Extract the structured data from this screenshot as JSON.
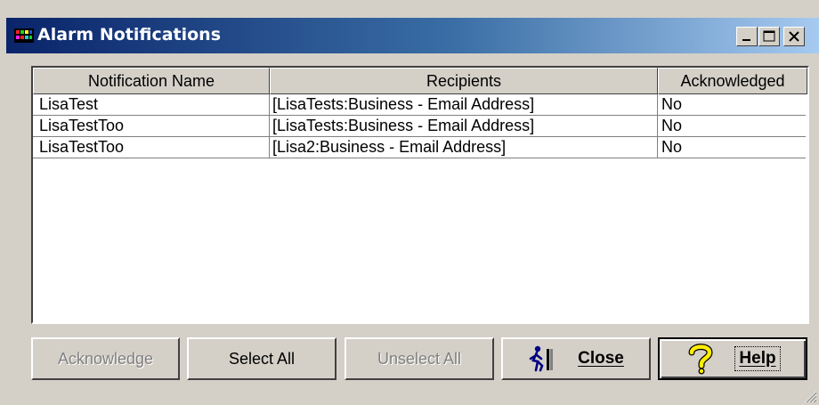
{
  "window": {
    "title": "Alarm Notifications",
    "icon": "alarm-app-icon",
    "controls": {
      "minimize_glyph": "_",
      "maximize_glyph": "☐",
      "close_glyph": "✕"
    }
  },
  "list": {
    "columns": [
      "Notification Name",
      "Recipients",
      "Acknowledged"
    ],
    "rows": [
      {
        "name": "LisaTest",
        "recipients": "[LisaTests:Business - Email Address]",
        "acknowledged": "No"
      },
      {
        "name": "LisaTestToo",
        "recipients": "[LisaTests:Business - Email Address]",
        "acknowledged": "No"
      },
      {
        "name": "LisaTestToo",
        "recipients": "[Lisa2:Business - Email Address]",
        "acknowledged": "No"
      }
    ]
  },
  "buttons": {
    "acknowledge": "Acknowledge",
    "select_all": "Select All",
    "unselect_all": "Unselect All",
    "close": "Close",
    "help": "Help"
  },
  "icons": {
    "close_icon": "exit-running-man-icon",
    "help_icon": "question-mark-icon"
  },
  "colors": {
    "titlebar_start": "#0a246a",
    "titlebar_end": "#a6caf0",
    "face": "#d4d0c8",
    "disabled_text": "#808080"
  }
}
